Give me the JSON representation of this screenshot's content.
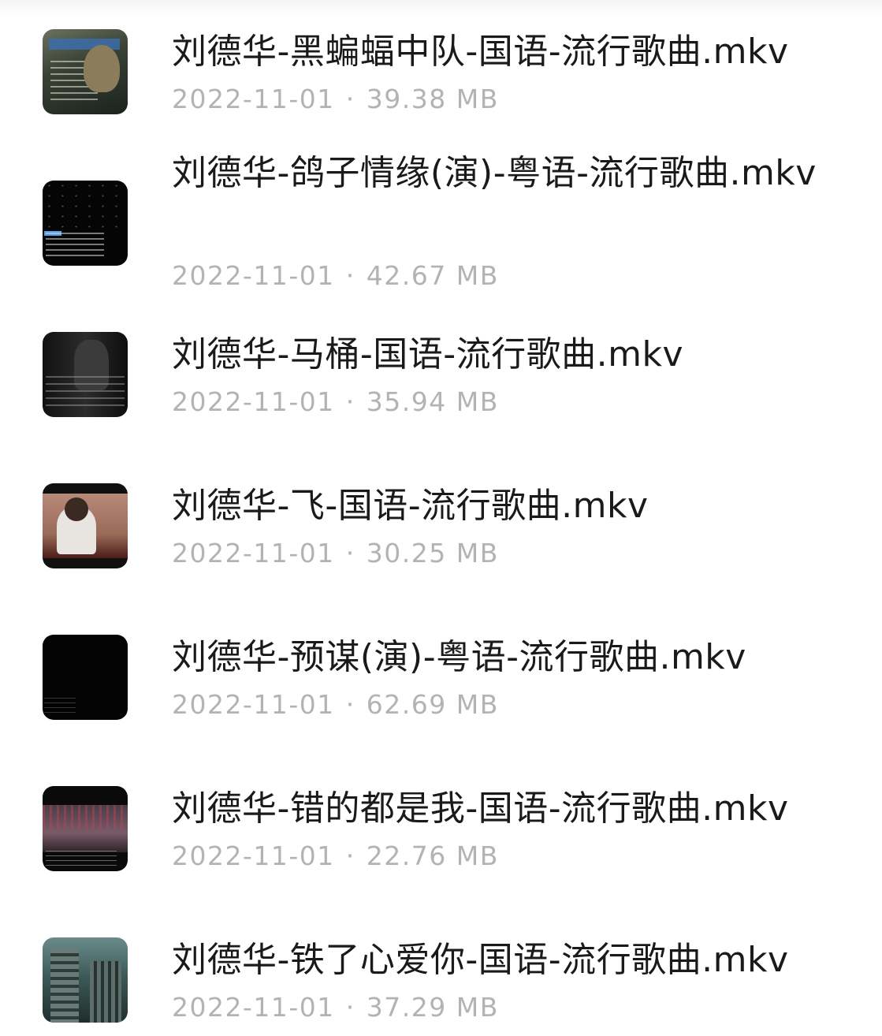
{
  "files": [
    {
      "title": "刘德华-黑蝙蝠中队-国语-流行歌曲.mkv",
      "date": "2022-11-01",
      "separator": "·",
      "size": "39.38 MB",
      "thumbnail_icon": "video-thumbnail"
    },
    {
      "title": "刘德华-鸽子情缘(演)-粤语-流行歌曲.mkv",
      "date": "2022-11-01",
      "separator": "·",
      "size": "42.67 MB",
      "thumbnail_icon": "video-thumbnail"
    },
    {
      "title": "刘德华-马桶-国语-流行歌曲.mkv",
      "date": "2022-11-01",
      "separator": "·",
      "size": "35.94 MB",
      "thumbnail_icon": "video-thumbnail"
    },
    {
      "title": "刘德华-飞-国语-流行歌曲.mkv",
      "date": "2022-11-01",
      "separator": "·",
      "size": "30.25 MB",
      "thumbnail_icon": "video-thumbnail"
    },
    {
      "title": "刘德华-预谋(演)-粤语-流行歌曲.mkv",
      "date": "2022-11-01",
      "separator": "·",
      "size": "62.69 MB",
      "thumbnail_icon": "video-thumbnail"
    },
    {
      "title": "刘德华-错的都是我-国语-流行歌曲.mkv",
      "date": "2022-11-01",
      "separator": "·",
      "size": "22.76 MB",
      "thumbnail_icon": "video-thumbnail"
    },
    {
      "title": "刘德华-铁了心爱你-国语-流行歌曲.mkv",
      "date": "2022-11-01",
      "separator": "·",
      "size": "37.29 MB",
      "thumbnail_icon": "video-thumbnail"
    }
  ]
}
